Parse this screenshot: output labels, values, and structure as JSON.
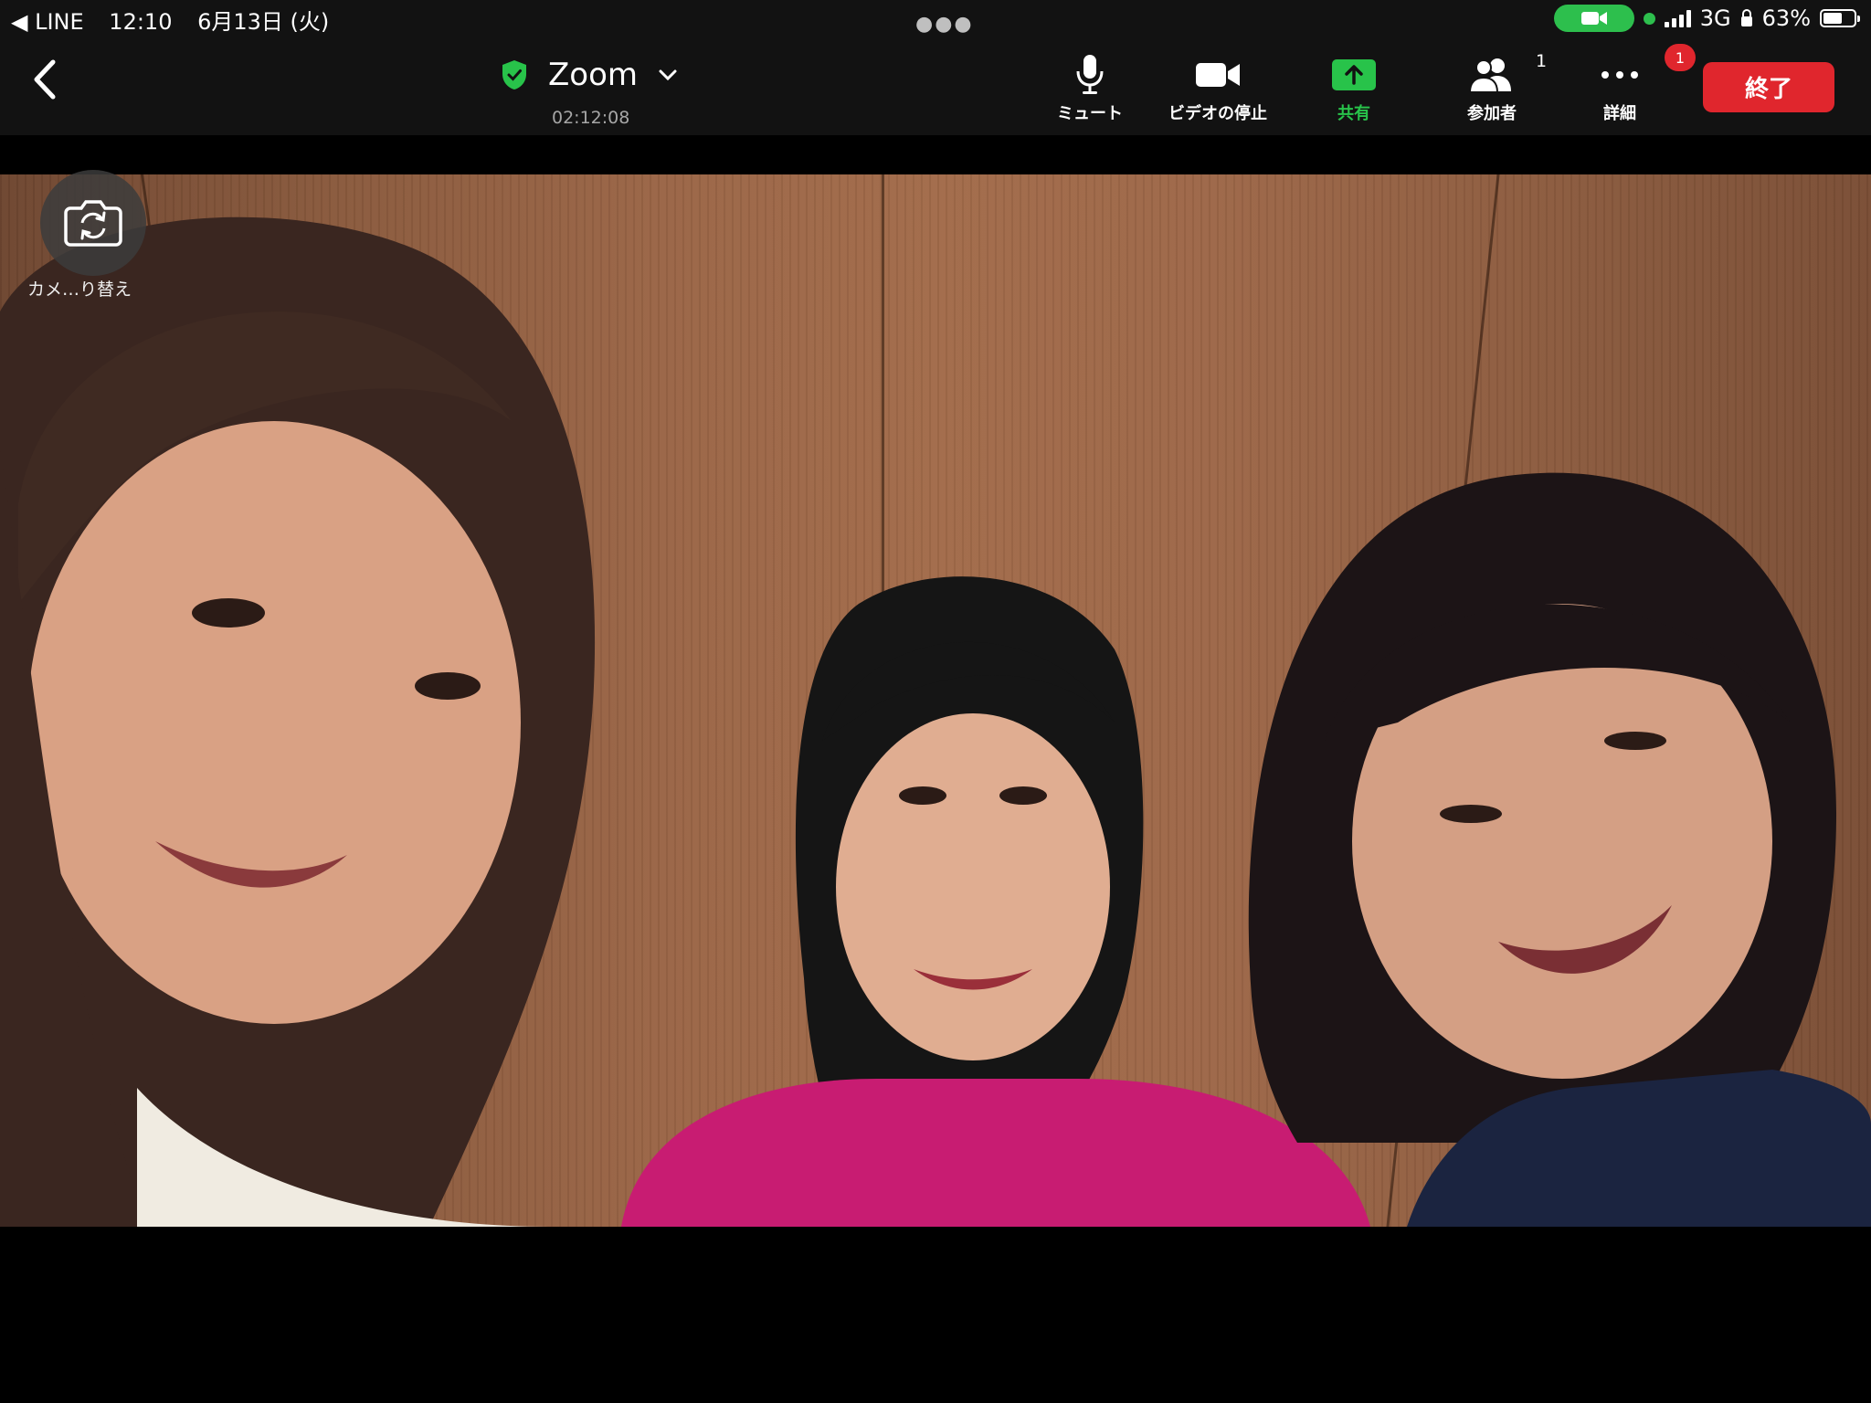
{
  "status_bar": {
    "back_app": "◀ LINE",
    "time": "12:10",
    "date": "6月13日 (火)",
    "network": "3G",
    "battery": "63%",
    "battery_level": 0.63
  },
  "toolbar": {
    "title": "Zoom",
    "timer": "02:12:08",
    "mute_label": "ミュート",
    "video_label": "ビデオの停止",
    "share_label": "共有",
    "participants_label": "参加者",
    "participants_count": "1",
    "more_label": "詳細",
    "more_badge": "1",
    "end_label": "終了"
  },
  "video": {
    "flip_camera_label": "カメ…り替え"
  },
  "colors": {
    "bar_bg": "#121212",
    "accent_green": "#28c34a",
    "end_red": "#e0262d"
  }
}
